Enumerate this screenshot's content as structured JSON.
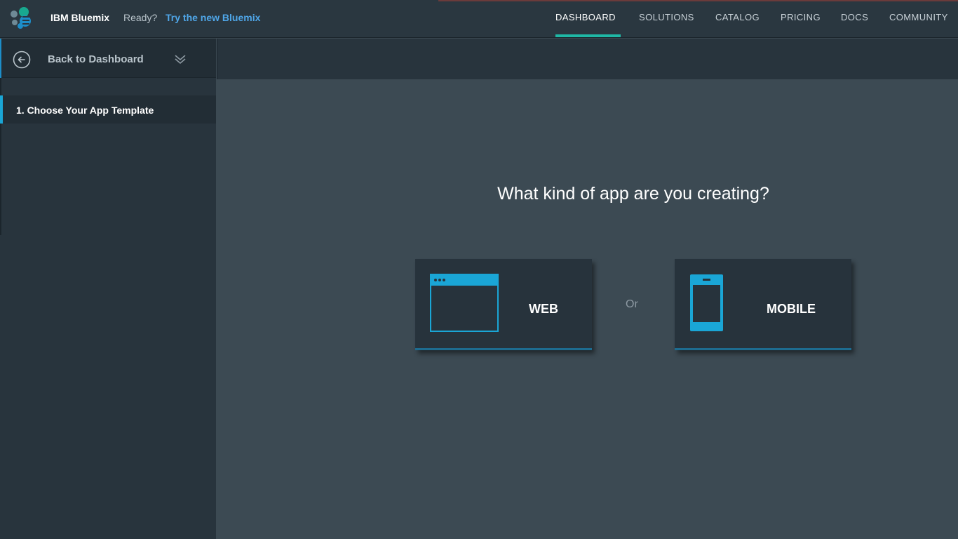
{
  "header": {
    "brand": "IBM Bluemix",
    "ready_text": "Ready?",
    "try_link": "Try the new Bluemix",
    "nav": [
      {
        "label": "DASHBOARD",
        "active": true
      },
      {
        "label": "SOLUTIONS",
        "active": false
      },
      {
        "label": "CATALOG",
        "active": false
      },
      {
        "label": "PRICING",
        "active": false
      },
      {
        "label": "DOCS",
        "active": false
      },
      {
        "label": "COMMUNITY",
        "active": false
      }
    ],
    "accent_color": "#1fb8a6"
  },
  "sidebar": {
    "back_label": "Back to Dashboard",
    "steps": [
      {
        "label": "1. Choose Your App Template",
        "active": true
      }
    ]
  },
  "main": {
    "question": "What kind of app are you creating?",
    "options": [
      {
        "label": "WEB",
        "icon": "browser-window-icon"
      },
      {
        "label": "MOBILE",
        "icon": "mobile-phone-icon"
      }
    ],
    "separator": "Or"
  },
  "colors": {
    "brand_blue": "#1aa6d6",
    "link_blue": "#4fa6e8"
  }
}
